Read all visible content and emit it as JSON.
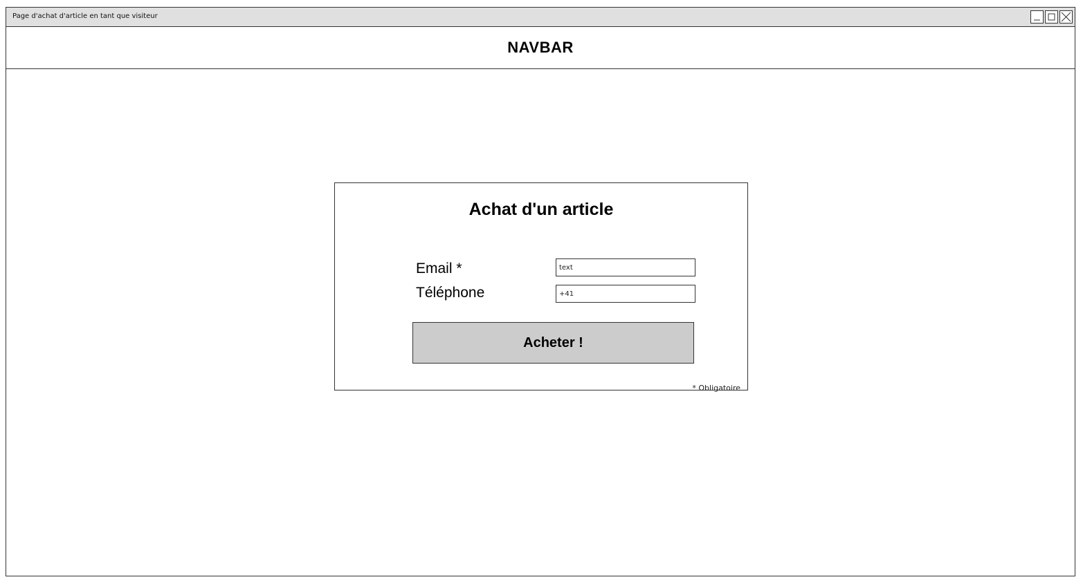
{
  "window": {
    "title": "Page d'achat d'article en tant que visiteur",
    "controls": [
      "minimize-icon",
      "maximize-icon",
      "close-icon"
    ]
  },
  "navbar": {
    "title": "NAVBAR"
  },
  "form": {
    "title": "Achat d'un article",
    "email_label": "Email *",
    "email_value": "text",
    "phone_label": "Téléphone",
    "phone_value": "+41",
    "submit_label": "Acheter !",
    "footnote": "* Obligatoire"
  },
  "colors": {
    "titlebar_bg": "#e0e0e0",
    "button_bg": "#cccccc",
    "border": "#333333"
  }
}
